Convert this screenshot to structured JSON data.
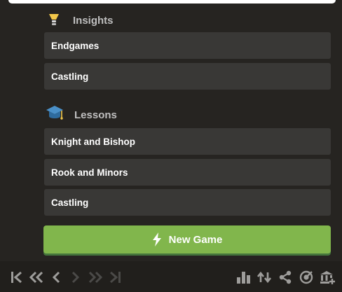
{
  "insights": {
    "title": "Insights",
    "items": [
      {
        "label": "Endgames"
      },
      {
        "label": "Castling"
      }
    ]
  },
  "lessons": {
    "title": "Lessons",
    "items": [
      {
        "label": "Knight and Bishop"
      },
      {
        "label": "Rook and Minors"
      },
      {
        "label": "Castling"
      }
    ]
  },
  "new_game": {
    "label": "New Game",
    "icon": "lightning-icon"
  },
  "nav": {
    "icons": [
      "first-move-icon",
      "previous-fast-icon",
      "previous-move-icon",
      "next-move-icon",
      "next-fast-icon",
      "last-move-icon"
    ]
  },
  "tools": {
    "icons": [
      "analysis-chart-icon",
      "flip-board-icon",
      "share-icon",
      "target-icon",
      "museum-icon"
    ]
  },
  "colors": {
    "background": "#262421",
    "row": "#393836",
    "accent_green": "#81b64c",
    "header_text": "#bfbfbf",
    "active_icon": "#9e9d9b",
    "disabled_icon": "#4b4a48"
  }
}
